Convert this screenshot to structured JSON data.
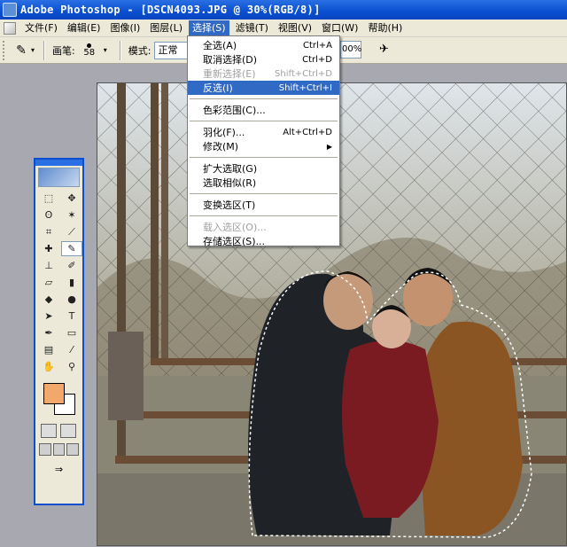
{
  "titlebar": {
    "title": "Adobe Photoshop - [DSCN4093.JPG @ 30%(RGB/8)]"
  },
  "menubar": {
    "items": [
      "文件(F)",
      "编辑(E)",
      "图像(I)",
      "图层(L)",
      "选择(S)",
      "滤镜(T)",
      "视图(V)",
      "窗口(W)",
      "帮助(H)"
    ],
    "active_index": 4
  },
  "options": {
    "brush_label": "画笔:",
    "brush_size": "58",
    "mode_label": "模式:",
    "mode_value": "正常",
    "opacity_value": "00%"
  },
  "select_menu": {
    "groups": [
      [
        {
          "label": "全选(A)",
          "shortcut": "Ctrl+A",
          "disabled": false
        },
        {
          "label": "取消选择(D)",
          "shortcut": "Ctrl+D",
          "disabled": false
        },
        {
          "label": "重新选择(E)",
          "shortcut": "Shift+Ctrl+D",
          "disabled": true
        },
        {
          "label": "反选(I)",
          "shortcut": "Shift+Ctrl+I",
          "disabled": false,
          "highlight": true
        }
      ],
      [
        {
          "label": "色彩范围(C)...",
          "shortcut": "",
          "disabled": false
        }
      ],
      [
        {
          "label": "羽化(F)...",
          "shortcut": "Alt+Ctrl+D",
          "disabled": false
        },
        {
          "label": "修改(M)",
          "shortcut": "",
          "disabled": false,
          "submenu": true
        }
      ],
      [
        {
          "label": "扩大选取(G)",
          "shortcut": "",
          "disabled": false
        },
        {
          "label": "选取相似(R)",
          "shortcut": "",
          "disabled": false
        }
      ],
      [
        {
          "label": "变换选区(T)",
          "shortcut": "",
          "disabled": false
        }
      ],
      [
        {
          "label": "载入选区(O)...",
          "shortcut": "",
          "disabled": true
        },
        {
          "label": "存储选区(S)...",
          "shortcut": "",
          "disabled": false
        }
      ]
    ]
  },
  "toolbox": {
    "tools": [
      {
        "icon": "rect-marquee-icon",
        "glyph": "⬚"
      },
      {
        "icon": "move-icon",
        "glyph": "✥"
      },
      {
        "icon": "lasso-icon",
        "glyph": "ʘ"
      },
      {
        "icon": "magic-wand-icon",
        "glyph": "✶"
      },
      {
        "icon": "crop-icon",
        "glyph": "⌗"
      },
      {
        "icon": "slice-icon",
        "glyph": "⟋"
      },
      {
        "icon": "healing-brush-icon",
        "glyph": "✚"
      },
      {
        "icon": "brush-icon",
        "glyph": "✎"
      },
      {
        "icon": "clone-stamp-icon",
        "glyph": "⊥"
      },
      {
        "icon": "history-brush-icon",
        "glyph": "✐"
      },
      {
        "icon": "eraser-icon",
        "glyph": "▱"
      },
      {
        "icon": "gradient-icon",
        "glyph": "▮"
      },
      {
        "icon": "blur-icon",
        "glyph": "◆"
      },
      {
        "icon": "dodge-icon",
        "glyph": "●"
      },
      {
        "icon": "path-select-icon",
        "glyph": "➤"
      },
      {
        "icon": "type-icon",
        "glyph": "T"
      },
      {
        "icon": "pen-icon",
        "glyph": "✒"
      },
      {
        "icon": "shape-icon",
        "glyph": "▭"
      },
      {
        "icon": "notes-icon",
        "glyph": "▤"
      },
      {
        "icon": "eyedropper-icon",
        "glyph": "⁄"
      },
      {
        "icon": "hand-icon",
        "glyph": "✋"
      },
      {
        "icon": "zoom-icon",
        "glyph": "⚲"
      }
    ],
    "selected_index": 7,
    "foreground_color": "#f1a86a",
    "background_color": "#ffffff"
  }
}
